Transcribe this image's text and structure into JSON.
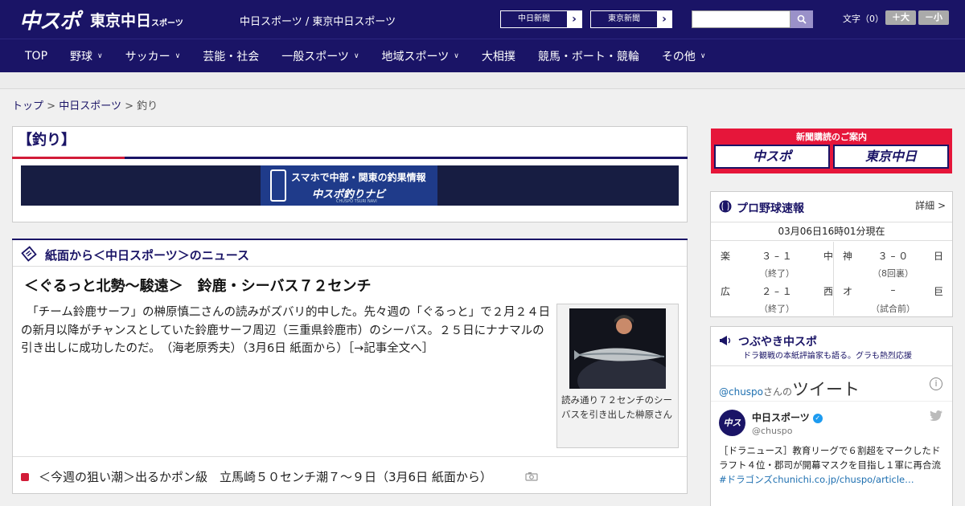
{
  "header": {
    "logo_main": "中スポ",
    "logo_tokyo": "東京中日",
    "logo_tokyo_small": "スポーツ",
    "site_names": "中日スポーツ / 東京中日スポーツ",
    "paper_links": [
      "中日新聞",
      "東京新聞"
    ],
    "search": {
      "placeholder": "",
      "value": ""
    },
    "font_label": "文字（0）",
    "font_bigger": "＋大",
    "font_smaller": "－小"
  },
  "nav": [
    {
      "label": "TOP",
      "has_dropdown": false
    },
    {
      "label": "野球",
      "has_dropdown": true
    },
    {
      "label": "サッカー",
      "has_dropdown": true
    },
    {
      "label": "芸能・社会",
      "has_dropdown": false
    },
    {
      "label": "一般スポーツ",
      "has_dropdown": true
    },
    {
      "label": "地域スポーツ",
      "has_dropdown": true
    },
    {
      "label": "大相撲",
      "has_dropdown": false
    },
    {
      "label": "競馬・ボート・競輪",
      "has_dropdown": false
    },
    {
      "label": "その他",
      "has_dropdown": true
    }
  ],
  "breadcrumb": {
    "items": [
      "トップ",
      "中日スポーツ",
      "釣り"
    ],
    "separator": ">"
  },
  "category": {
    "title": "【釣り】",
    "banner_line1": "スマホで中部・関東の釣果情報",
    "banner_line2": "中スポ釣りナビ",
    "banner_line3": "CHUSPO TSURI NAVI"
  },
  "news": {
    "section_title": "紙面から＜中日スポーツ＞のニュース",
    "article_title": "＜ぐるっと北勢～駿遠＞　鈴鹿・シーバス７２センチ",
    "article_body": "　「チーム鈴鹿サーフ」の榊原慎二さんの読みがズバリ的中した。先々週の「ぐるっと」で２月２４日の新月以降がチャンスとしていた鈴鹿サーフ周辺（三重県鈴鹿市）のシーバス。２５日にナナマルの引き出しに成功したのだ。　（海老原秀夫）（3月6日 紙面から）［→記事全文へ］",
    "photo_caption": "読み通り７２センチのシーバスを引き出した榊原さん",
    "list": [
      {
        "text": "＜今週の狙い潮＞出るかポン級　立馬崎５０センチ潮７～９日（3月6日 紙面から）"
      }
    ]
  },
  "subscription": {
    "title": "新聞購読のご案内",
    "logos": [
      "中スポ",
      "東京中日"
    ]
  },
  "baseball": {
    "title": "プロ野球速報",
    "detail": "詳細 >",
    "timestamp": "03月06日16時01分現在",
    "games": [
      {
        "home": "楽",
        "score": "３ – １",
        "away": "中",
        "status": "（終了）"
      },
      {
        "home": "神",
        "score": "３ – ０",
        "away": "日",
        "status": "（8回裏）"
      },
      {
        "home": "広",
        "score": "２ – １",
        "away": "西",
        "status": "（終了）"
      },
      {
        "home": "オ",
        "score": "–",
        "away": "巨",
        "status": "（試合前）"
      }
    ]
  },
  "twitter": {
    "title": "つぶやき中スポ",
    "subtitle": "ドラ観戦の本紙評論家も語る。グラも熱烈応援",
    "handle": "@chuspo",
    "handle_suffix": "さんの",
    "handle_big": "ツイート",
    "name": "中日スポーツ",
    "user": "@chuspo",
    "tweet_text": "［ドラニュース］教育リーグで６割超をマークしたドラフト４位・郡司が開幕マスクを目指し１軍に再合流",
    "tweet_tag": "#ドラゴンズ",
    "tweet_link": "chunichi.co.jp/chuspo/article…"
  }
}
